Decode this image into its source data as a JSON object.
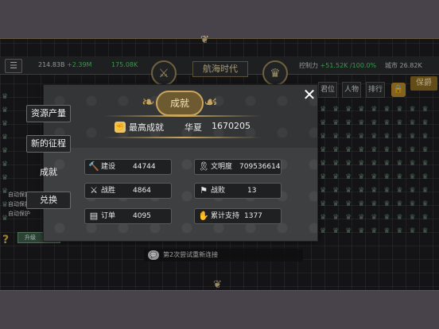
{
  "topbar": {
    "resource1": "214.83B",
    "resource1_delta": "+2.39M",
    "resource2": "175.08K",
    "era_title": "航海时代",
    "control_label": "控制力",
    "control_value": "+51.52K /100.0%",
    "city_label": "城市",
    "city_value": "26.82K"
  },
  "right_tabs": [
    "君位",
    "人物",
    "排行"
  ],
  "gold_tab": "保爵",
  "left_labels": [
    "自动保护",
    "自动保护",
    "自动保护"
  ],
  "upgrade_label": "升级",
  "bottom_message": "第2次尝试重新连接",
  "modal": {
    "title": "成就",
    "best_label": "最高成就",
    "best_nation": "华夏",
    "best_score": "1670205",
    "side_buttons": [
      "资源产量",
      "新的征程",
      "成就",
      "兑换"
    ],
    "stats": [
      {
        "icon": "hammer-icon",
        "glyph": "🔨",
        "label": "建设",
        "value": "44744"
      },
      {
        "icon": "ribbon-icon",
        "glyph": "🎗",
        "label": "文明度",
        "value": "709536614"
      },
      {
        "icon": "crossed-swords-icon",
        "glyph": "⚔",
        "label": "战胜",
        "value": "4864"
      },
      {
        "icon": "flag-icon",
        "glyph": "⚑",
        "label": "战败",
        "value": "13"
      },
      {
        "icon": "document-icon",
        "glyph": "▤",
        "label": "订单",
        "value": "4095"
      },
      {
        "icon": "handshake-icon",
        "glyph": "✋",
        "label": "累计支持",
        "value": "1377"
      }
    ]
  }
}
